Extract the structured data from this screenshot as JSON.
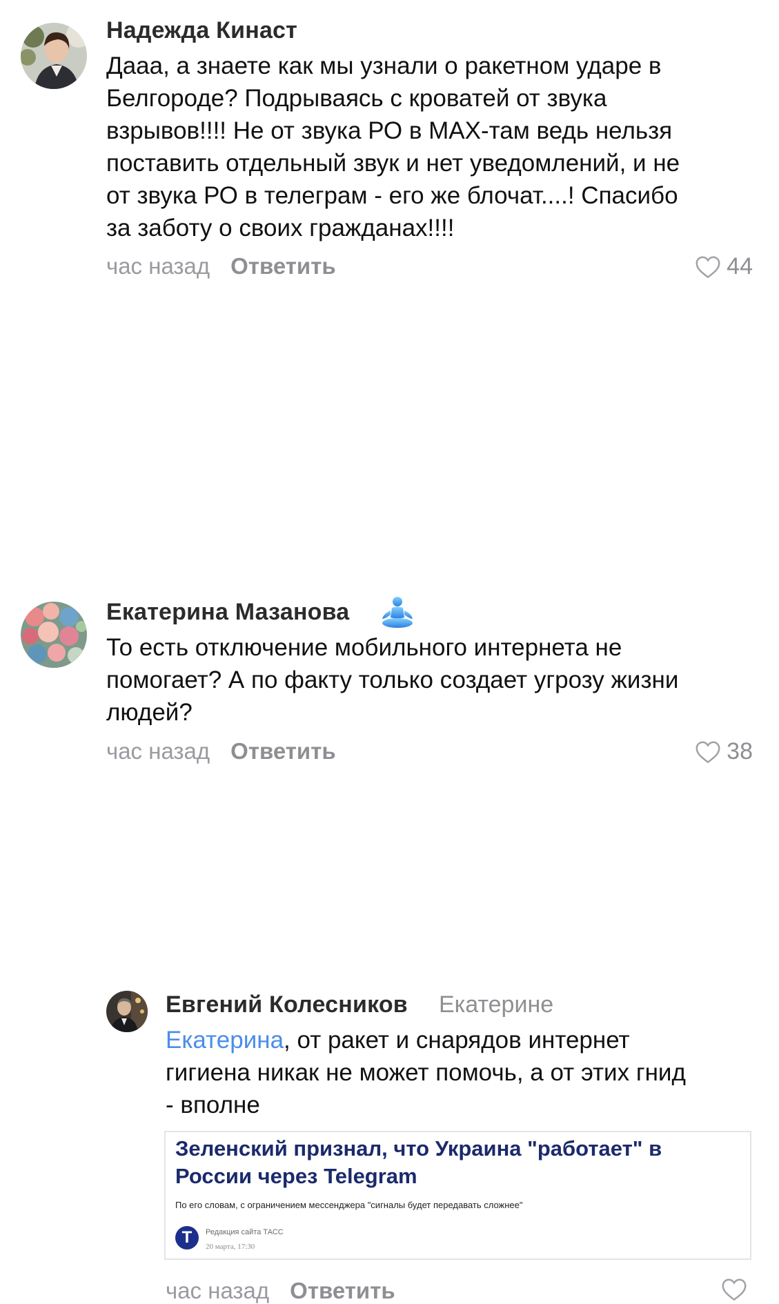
{
  "comments": [
    {
      "author": "Надежда Кинаст",
      "text_lines": [
        "Дааа, а знаете как мы узнали о ракетном ударе в",
        "Белгороде? Подрываясь с кроватей от звука",
        "взрывов!!!! Не от звука РО в MAX-там ведь нельзя",
        "поставить отдельный звук и нет уведомлений, и не",
        "от звука РО в телеграм - его же блочат....! Спасибо",
        "за заботу о своих гражданах!!!!"
      ],
      "time": "час назад",
      "reply_label": "Ответить",
      "likes": "44"
    },
    {
      "author": "Екатерина Мазанова",
      "author_emoji": "meditating-person-emoji",
      "text_lines": [
        "То есть отключение мобильного интернета не",
        "помогает? А по факту только создает угрозу жизни",
        "людей?"
      ],
      "time": "час назад",
      "reply_label": "Ответить",
      "likes": "38"
    },
    {
      "author": "Евгений Колесников",
      "reply_to": "Екатерине",
      "mention": "Екатерина",
      "text_lines": [
        ", от ракет и снарядов интернет",
        "гигиена никак не может помочь, а от этих гнид",
        "- вполне"
      ],
      "attachment": {
        "title": "Зеленский признал, что Украина \"работает\" в России через Telegram",
        "subtitle": "По его словам, с ограничением мессенджера \"сигналы будет передавать сложнее\"",
        "source_logo_letter": "Т",
        "source": "Редакция сайта ТАСС",
        "date": "20 марта, 17:30"
      },
      "time": "час назад",
      "reply_label": "Ответить",
      "likes": ""
    }
  ],
  "colors": {
    "mention": "#4a8ee8",
    "meta_gray": "#8e8e93",
    "article_title": "#1b2a6b",
    "tass_blue": "#1d2f8c"
  },
  "icons": {
    "like": "heart-outline-icon"
  }
}
